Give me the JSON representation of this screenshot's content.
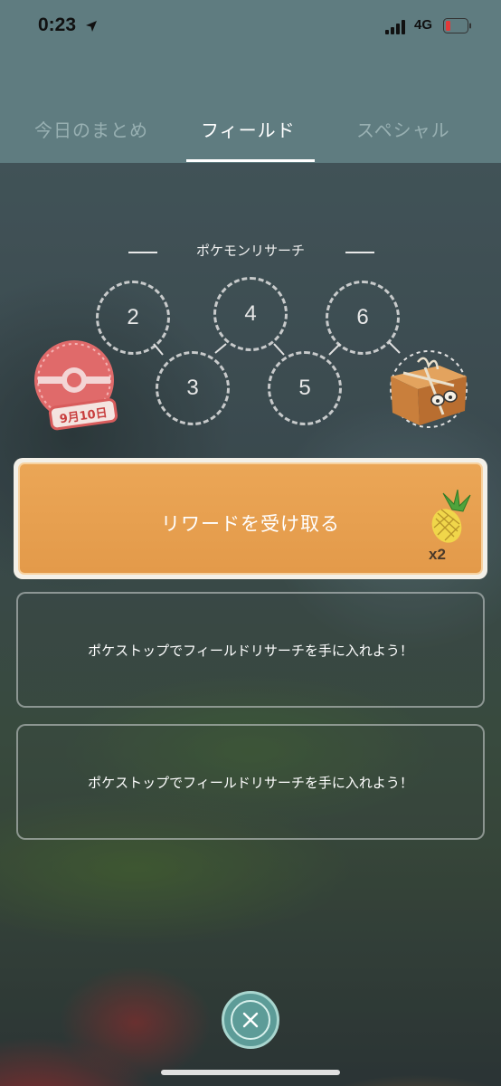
{
  "status_bar": {
    "time": "0:23",
    "network": "4G",
    "battery_color": "#e23a3a"
  },
  "tabs": [
    {
      "label": "今日のまとめ",
      "active": false
    },
    {
      "label": "フィールド",
      "active": true
    },
    {
      "label": "スペシャル",
      "active": false
    }
  ],
  "research": {
    "title": "ポケモンリサーチ",
    "steps": [
      "2",
      "3",
      "4",
      "5",
      "6"
    ],
    "stamp_date": "9月10日",
    "stamp_icon": "pokeball-stamp-icon",
    "reward_icon": "box-icon"
  },
  "claim": {
    "label": "リワードを受け取る",
    "reward_icon": "pinap-berry-icon",
    "quantity": "x2",
    "color": "#e8a050"
  },
  "tasks": [
    {
      "text": "ポケストップでフィールドリサーチを手に入れよう！"
    },
    {
      "text": "ポケストップでフィールドリサーチを手に入れよう！"
    }
  ],
  "close_icon": "close-icon",
  "accent": "#5d9c98"
}
